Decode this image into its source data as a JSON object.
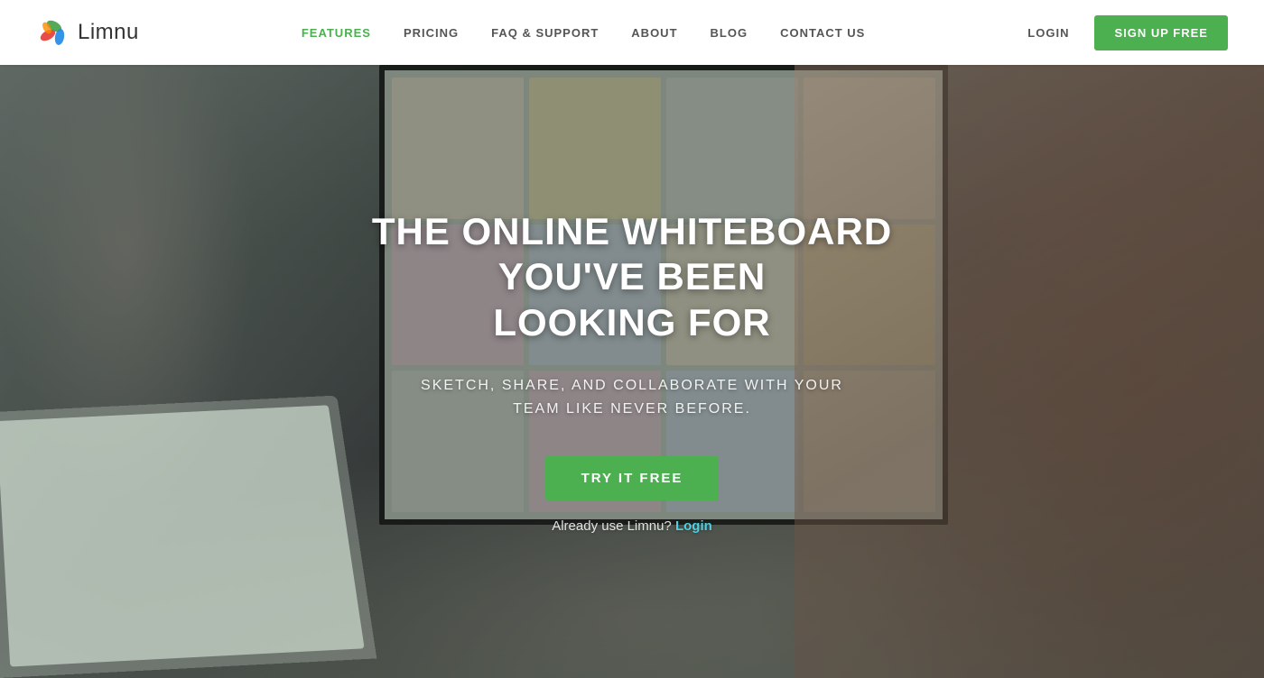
{
  "header": {
    "logo_text": "Limnu",
    "nav": {
      "items": [
        {
          "label": "FEATURES",
          "active": true
        },
        {
          "label": "PRICING",
          "active": false
        },
        {
          "label": "FAQ & SUPPORT",
          "active": false
        },
        {
          "label": "ABOUT",
          "active": false
        },
        {
          "label": "BLOG",
          "active": false
        },
        {
          "label": "CONTACT US",
          "active": false
        }
      ],
      "login_label": "LOGIN",
      "signup_label": "SIGN UP FREE"
    }
  },
  "hero": {
    "title_line1": "THE ONLINE WHITEBOARD YOU'VE BEEN",
    "title_line2": "LOOKING FOR",
    "subtitle": "SKETCH, SHARE, AND COLLABORATE WITH YOUR TEAM LIKE NEVER BEFORE.",
    "cta_button": "TRY IT FREE",
    "already_text": "Already use Limnu?",
    "login_cta": "Login"
  },
  "colors": {
    "green": "#4caf50",
    "teal": "#4dd0e1",
    "nav_active": "#4caf50",
    "text_dark": "#333333",
    "text_mid": "#555555"
  }
}
